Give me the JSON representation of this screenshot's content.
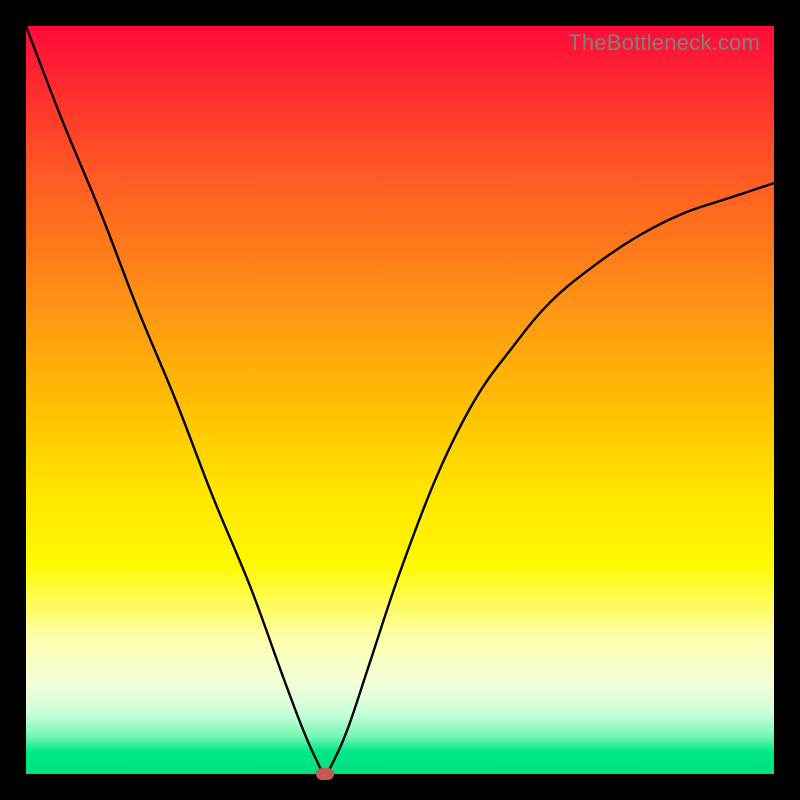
{
  "watermark": "TheBottleneck.com",
  "chart_data": {
    "type": "line",
    "title": "",
    "xlabel": "",
    "ylabel": "",
    "xlim": [
      0,
      100
    ],
    "ylim": [
      0,
      100
    ],
    "grid": false,
    "curve_description": "V-shaped bottleneck curve: steep descent from upper-left to a minimum near x≈40 at y≈0, then curved rise toward upper-right leveling off.",
    "series": [
      {
        "name": "bottleneck-curve",
        "x": [
          0,
          5,
          10,
          15,
          20,
          25,
          30,
          34,
          37,
          39,
          40,
          41,
          43,
          46,
          50,
          55,
          60,
          65,
          70,
          76,
          82,
          88,
          94,
          100
        ],
        "y": [
          100,
          87,
          75,
          62,
          50,
          37,
          25,
          14,
          6,
          1.5,
          0,
          1.5,
          6,
          15,
          27,
          40,
          50,
          57,
          63,
          68,
          72,
          75,
          77,
          79
        ]
      }
    ],
    "marker": {
      "x_pct": 40,
      "y_pct": 0,
      "color": "#c35a53"
    },
    "background_gradient": {
      "top": "#ff0a3a",
      "bottom": "#00e080",
      "meaning": "red=high bottleneck, green=low bottleneck"
    }
  }
}
